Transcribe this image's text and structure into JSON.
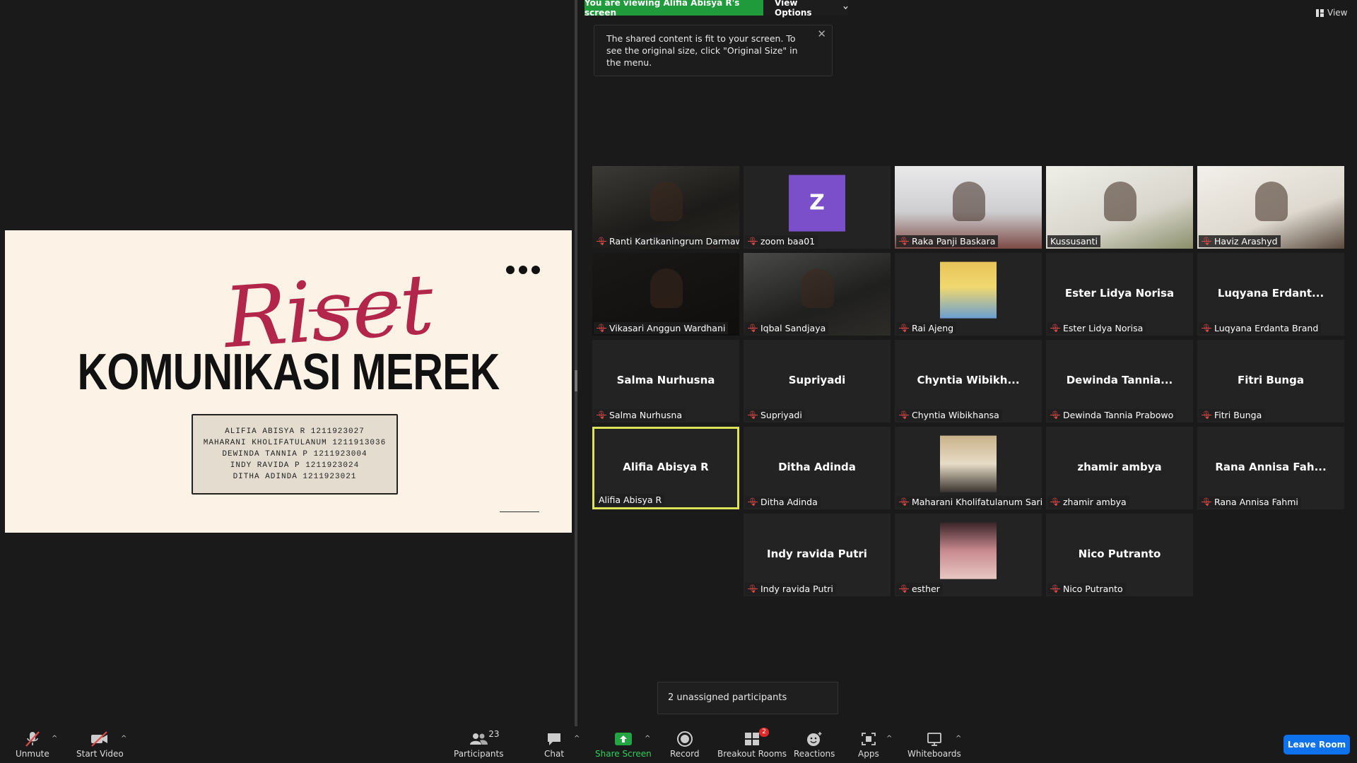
{
  "banner": {
    "viewing": "You are viewing Alifia Abisya R's screen",
    "view_options": "View Options"
  },
  "tooltip": {
    "text": "The shared content is fit to your screen. To see the original size, click \"Original Size\" in the menu."
  },
  "view_button": {
    "label": "View"
  },
  "slide": {
    "script_title": "Riset",
    "main_title": "KOMUNIKASI MEREK",
    "members": [
      "ALIFIA ABISYA R 1211923027",
      "MAHARANI KHOLIFATULANUM 1211913036",
      "DEWINDA TANNIA P 1211923004",
      "INDY RAVIDA P 1211923024",
      "DITHA ADINDA 1211923021"
    ]
  },
  "tiles": [
    {
      "center": "",
      "label": "Ranti Kartikaningrum Darmaw...",
      "muted": true,
      "visual": "video-dark"
    },
    {
      "center": "",
      "label": "zoom baa01",
      "muted": true,
      "visual": "avatar-z"
    },
    {
      "center": "",
      "label": "Raka Panji Baskara",
      "muted": true,
      "visual": "video-room"
    },
    {
      "center": "",
      "label": "Kussusanti",
      "muted": false,
      "visual": "video-light"
    },
    {
      "center": "",
      "label": "Haviz Arashyd",
      "muted": true,
      "visual": "video-light2"
    },
    {
      "center": "",
      "label": "Vikasari Anggun Wardhani",
      "muted": true,
      "visual": "video-black"
    },
    {
      "center": "",
      "label": "Iqbal Sandjaya",
      "muted": true,
      "visual": "video-mid"
    },
    {
      "center": "",
      "label": "Rai Ajeng",
      "muted": true,
      "visual": "photo-yellow"
    },
    {
      "center": "Ester Lidya Norisa",
      "label": "Ester Lidya Norisa",
      "muted": true,
      "visual": "name"
    },
    {
      "center": "Luqyana  Erdant...",
      "label": "Luqyana Erdanta Brand",
      "muted": true,
      "visual": "name"
    },
    {
      "center": "Salma Nurhusna",
      "label": "Salma Nurhusna",
      "muted": true,
      "visual": "name"
    },
    {
      "center": "Supriyadi",
      "label": "Supriyadi",
      "muted": true,
      "visual": "name"
    },
    {
      "center": "Chyntia  Wibikh...",
      "label": "Chyntia Wibikhansa",
      "muted": true,
      "visual": "name"
    },
    {
      "center": "Dewinda  Tannia...",
      "label": "Dewinda Tannia Prabowo",
      "muted": true,
      "visual": "name"
    },
    {
      "center": "Fitri Bunga",
      "label": "Fitri Bunga",
      "muted": true,
      "visual": "name"
    },
    {
      "center": "Alifia Abisya R",
      "label": "Alifia Abisya R",
      "muted": false,
      "visual": "name",
      "active": true
    },
    {
      "center": "Ditha Adinda",
      "label": "Ditha Adinda",
      "muted": true,
      "visual": "name"
    },
    {
      "center": "",
      "label": "Maharani Kholifatulanum Sari",
      "muted": true,
      "visual": "photo-warm"
    },
    {
      "center": "zhamir ambya",
      "label": "zhamir ambya",
      "muted": true,
      "visual": "name"
    },
    {
      "center": "Rana Annisa Fah...",
      "label": "Rana Annisa Fahmi",
      "muted": true,
      "visual": "name"
    },
    {
      "center": "Indy ravida Putri",
      "label": "Indy ravida Putri",
      "muted": true,
      "visual": "name"
    },
    {
      "center": "",
      "label": "esther",
      "muted": true,
      "visual": "photo-pink"
    },
    {
      "center": "Nico Putranto",
      "label": "Nico Putranto",
      "muted": true,
      "visual": "name"
    }
  ],
  "avatar_z_letter": "Z",
  "unassigned": "2 unassigned participants",
  "toolbar": {
    "unmute": "Unmute",
    "start_video": "Start Video",
    "participants": "Participants",
    "participants_count": "23",
    "chat": "Chat",
    "share_screen": "Share Screen",
    "record": "Record",
    "breakout_rooms": "Breakout Rooms",
    "breakout_badge": "2",
    "reactions": "Reactions",
    "apps": "Apps",
    "whiteboards": "Whiteboards",
    "leave_room": "Leave Room"
  },
  "colors": {
    "share_green": "#1f9b3c",
    "active_speaker": "#dde358",
    "leave_blue": "#0e72ed",
    "muted_red": "#e04848",
    "slide_accent": "#b3264b",
    "avatar_purple": "#7a4fc9"
  }
}
